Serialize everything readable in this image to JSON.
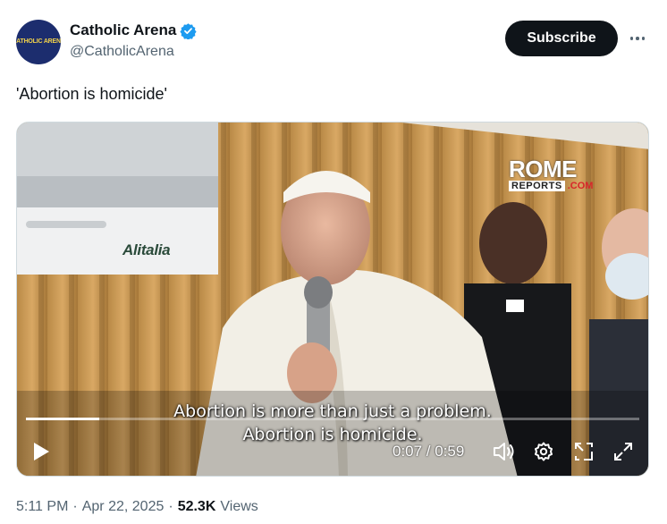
{
  "author": {
    "display_name": "Catholic Arena",
    "handle": "@CatholicArena",
    "avatar_text": "CATHOLIC ARENA",
    "verified_icon": "verified-badge-icon",
    "verified_color": "#1d9bf0"
  },
  "actions": {
    "subscribe_label": "Subscribe",
    "more_icon": "more-dots-icon"
  },
  "tweet": {
    "text": "'Abortion is homicide'"
  },
  "video": {
    "overlay_logo_top": "ROME",
    "overlay_logo_reports": "REPORTS",
    "overlay_logo_com": ".COM",
    "plane_logo": "Alitalia",
    "subtitle_line1": "Abortion is more than just a problem.",
    "subtitle_line2": "Abortion is homicide.",
    "time": "0:07 / 0:59",
    "progress_fraction": 0.12,
    "controls": [
      "play-icon",
      "volume-icon",
      "settings-icon",
      "picture-in-picture-icon",
      "fullscreen-icon"
    ]
  },
  "meta": {
    "time": "5:11 PM",
    "date": "Apr 22, 2025",
    "separator": "·",
    "views_count": "52.3K",
    "views_label": "Views"
  }
}
